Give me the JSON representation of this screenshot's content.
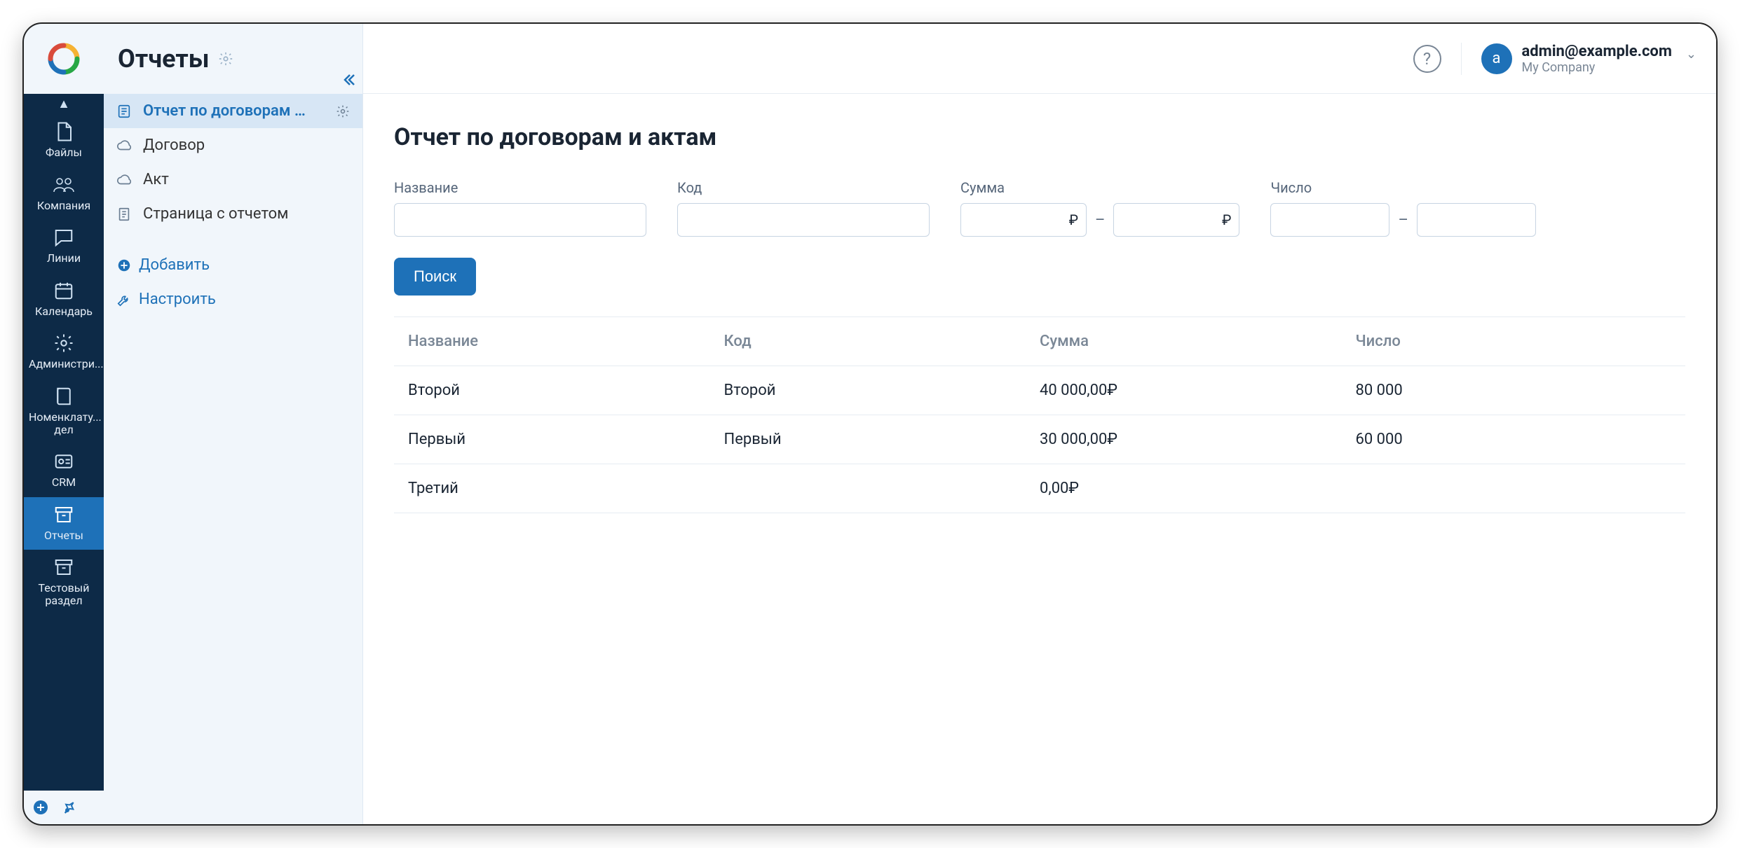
{
  "rail": {
    "items": [
      {
        "label": "Файлы"
      },
      {
        "label": "Компания"
      },
      {
        "label": "Линии"
      },
      {
        "label": "Календарь"
      },
      {
        "label": "Администри..."
      },
      {
        "label": "Номенклату... дел"
      },
      {
        "label": "CRM"
      },
      {
        "label": "Отчеты"
      },
      {
        "label": "Тестовый раздел"
      }
    ]
  },
  "sidepane": {
    "title": "Отчеты",
    "items": [
      {
        "label": "Отчет по договорам и ак..."
      },
      {
        "label": "Договор"
      },
      {
        "label": "Акт"
      },
      {
        "label": "Страница с отчетом"
      }
    ],
    "add_label": "Добавить",
    "configure_label": "Настроить"
  },
  "header": {
    "user_email": "admin@example.com",
    "user_org": "My Company",
    "avatar_letter": "a"
  },
  "main": {
    "title": "Отчет по договорам и актам",
    "filters": {
      "name_label": "Название",
      "code_label": "Код",
      "sum_label": "Сумма",
      "num_label": "Число",
      "currency": "₽",
      "dash": "–"
    },
    "search_label": "Поиск",
    "columns": {
      "name": "Название",
      "code": "Код",
      "sum": "Сумма",
      "num": "Число"
    },
    "rows": [
      {
        "name": "Второй",
        "code": "Второй",
        "sum": "40 000,00₽",
        "num": "80 000"
      },
      {
        "name": "Первый",
        "code": "Первый",
        "sum": "30 000,00₽",
        "num": "60 000"
      },
      {
        "name": "Третий",
        "code": "",
        "sum": "0,00₽",
        "num": ""
      }
    ]
  }
}
